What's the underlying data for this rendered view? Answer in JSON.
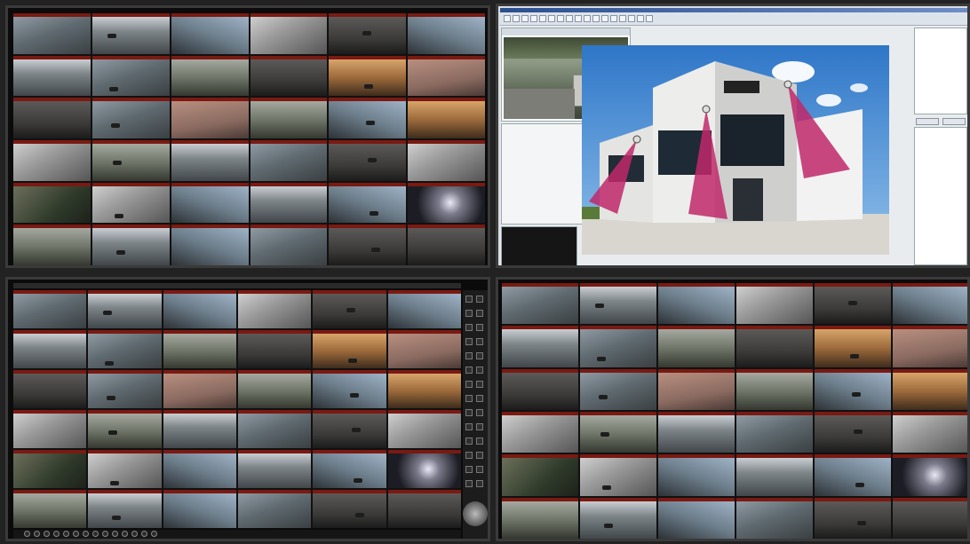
{
  "wall": {
    "monitors": [
      "top-left-camera-grid",
      "top-right-software",
      "bottom-left-camera-grid",
      "bottom-right-camera-grid"
    ]
  },
  "grid_top_left": {
    "cols": 6,
    "rows": 6
  },
  "grid_bottom_left": {
    "cols": 6,
    "rows": 6
  },
  "grid_bottom_right": {
    "cols": 6,
    "rows": 6
  },
  "software": {
    "building_sign": "",
    "preview_title": "",
    "preview_badge": "",
    "props": {
      "title": "",
      "rows": []
    },
    "buttons": [
      "",
      ""
    ],
    "tree": []
  },
  "colors": {
    "cam_header": "#7a1a12",
    "coverage_cone": "#c0286a",
    "sky": "#3f8ad6"
  },
  "icons": {
    "ptz": "ptz-joystick-icon",
    "camera": "camera-icon"
  }
}
